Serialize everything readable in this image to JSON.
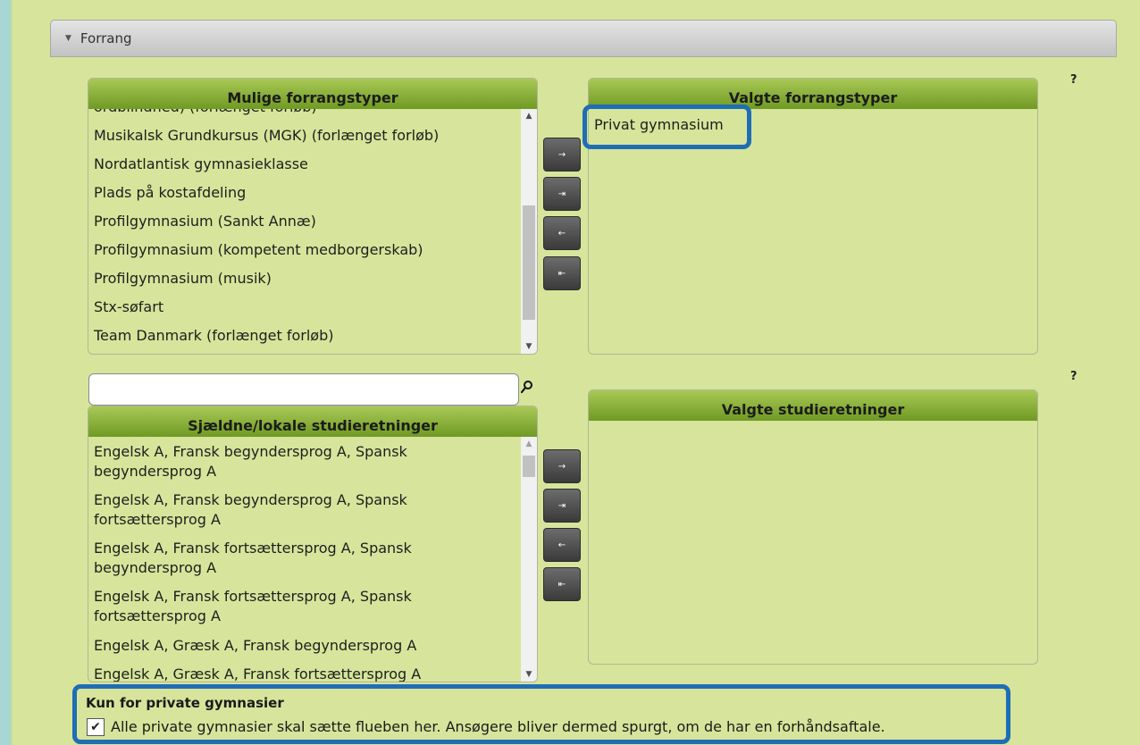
{
  "section": {
    "toggle_icon": "triangle-down-icon",
    "title": "Forrang"
  },
  "help_mark": "?",
  "mulige": {
    "header": "Mulige forrangstyper",
    "partial_top": "ordblindhed) (forlænget forløb)",
    "items": [
      "Musikalsk Grundkursus (MGK) (forlænget forløb)",
      "Nordatlantisk gymnasieklasse",
      "Plads på kostafdeling",
      "Profilgymnasium (Sankt Annæ)",
      "Profilgymnasium (kompetent medborgerskab)",
      "Profilgymnasium (musik)",
      "Stx-søfart",
      "Team Danmark (forlænget forløb)"
    ]
  },
  "valgte": {
    "header": "Valgte forrangstyper",
    "items": [
      "Privat gymnasium"
    ]
  },
  "move_buttons": {
    "add": "→",
    "add_all": "⇥",
    "remove": "←",
    "remove_all": "⇤"
  },
  "search": {
    "value": "",
    "placeholder": ""
  },
  "sjaeldne": {
    "header": "Sjældne/lokale studieretninger",
    "items": [
      "Engelsk A, Fransk begyndersprog A, Spansk begyndersprog A",
      "Engelsk A, Fransk begyndersprog A, Spansk fortsættersprog A",
      "Engelsk A, Fransk fortsættersprog A, Spansk begyndersprog A",
      "Engelsk A, Fransk fortsættersprog A, Spansk fortsættersprog A",
      "Engelsk A, Græsk A, Fransk begyndersprog A"
    ],
    "partial_bottom": "Engelsk A, Græsk A, Fransk fortsættersprog A"
  },
  "valgte_studieretninger": {
    "header": "Valgte studieretninger"
  },
  "private": {
    "title": "Kun for private gymnasier",
    "checkbox_checked": true,
    "checkbox_text": "Alle private gymnasier skal sætte flueben her. Ansøgere bliver dermed spurgt, om de har en forhåndsaftale."
  },
  "highlight_color": "#1f6db5"
}
